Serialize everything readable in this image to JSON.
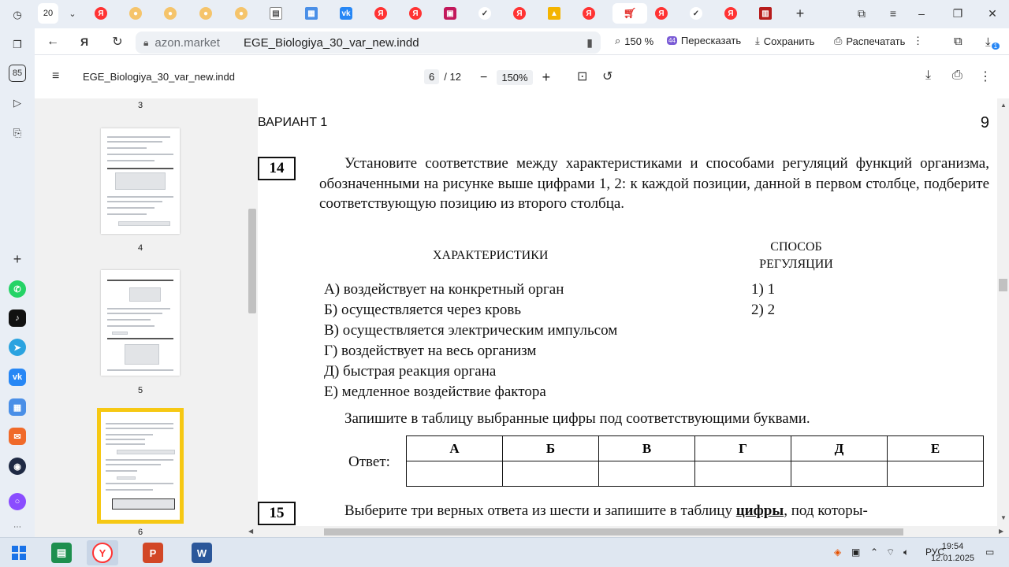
{
  "browser": {
    "tab_count_badge": "20",
    "address": {
      "domain": "azon.market",
      "title": "EGE_Biologiya_30_var_new.indd"
    },
    "tools": {
      "zoom": "150 %",
      "retell_badge": "44",
      "retell": "Пересказать",
      "save": "Сохранить",
      "print": "Распечатать"
    },
    "downloads_badge": "1",
    "rail_badge": "85"
  },
  "pdf": {
    "title": "EGE_Biologiya_30_var_new.indd",
    "page_current": "6",
    "page_total": "/ 12",
    "zoom": "150%",
    "thumbnails": [
      {
        "label": "3"
      },
      {
        "label": "4"
      },
      {
        "label": "5"
      },
      {
        "label": "6"
      }
    ]
  },
  "doc": {
    "variant": "ВАРИАНТ 1",
    "page_number": "9",
    "q14": {
      "number": "14",
      "text": "Установите соответствие между характеристиками и способами регуляций функций организма, обозначенными на рисунке выше цифрами 1, 2: к каждой позиции, данной в первом столбце, подберите соответствующую позицию из второго столбца.",
      "col1_header": "ХАРАКТЕРИСТИКИ",
      "col2_header_line1": "СПОСОБ",
      "col2_header_line2": "РЕГУЛЯЦИИ",
      "items": [
        "А) воздействует на конкретный орган",
        "Б) осуществляется через кровь",
        "В) осуществляется электрическим импульсом",
        "Г) воздействует на весь организм",
        "Д) быстрая реакция органа",
        "Е) медленное воздействие фактора"
      ],
      "options": [
        "1) 1",
        "2) 2"
      ],
      "instruction": "Запишите в таблицу выбранные цифры под соответствующими буквами.",
      "answer_label": "Ответ:",
      "answer_letters": [
        "А",
        "Б",
        "В",
        "Г",
        "Д",
        "Е"
      ]
    },
    "q15": {
      "number": "15",
      "text_before": "Выберите три верных ответа из шести и запишите в таблицу ",
      "text_bold": "цифры",
      "text_after": ", под которы-"
    }
  },
  "taskbar": {
    "lang": "РУС",
    "time": "19:54",
    "date": "12.01.2025"
  }
}
